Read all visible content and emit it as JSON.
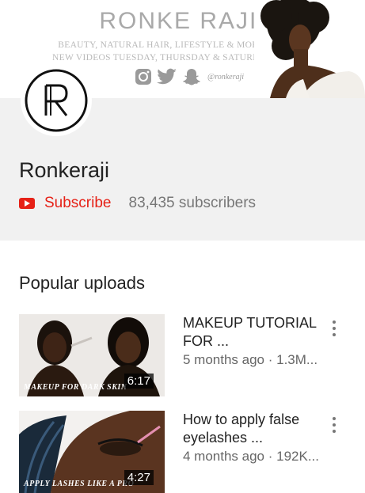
{
  "banner": {
    "title": "RONKE RAJI.",
    "line1": "BEAUTY, NATURAL HAIR, LIFESTYLE & MORE.",
    "line2": "NEW VIDEOS TUESDAY, THURSDAY & SATURDAY",
    "social_icons": [
      "instagram-icon",
      "twitter-icon",
      "snapchat-icon"
    ],
    "handle": "@ronkeraji"
  },
  "channel": {
    "name": "Ronkeraji",
    "subscribe_label": "Subscribe",
    "subscribers": "83,435 subscribers"
  },
  "section": {
    "title": "Popular uploads"
  },
  "videos": [
    {
      "title": "MAKEUP TUTORIAL FOR ...",
      "meta": "5 months ago · 1.3M...",
      "duration": "6:17",
      "thumb_caption": "MAKEUP FOR DARK SKIN"
    },
    {
      "title": "How to apply false eyelashes ...",
      "meta": "4 months ago · 192K...",
      "duration": "4:27",
      "thumb_caption": "APPLY LASHES LIKE A PRO"
    }
  ],
  "colors": {
    "accent": "#e62117",
    "info_bg": "#f1f1f1"
  }
}
